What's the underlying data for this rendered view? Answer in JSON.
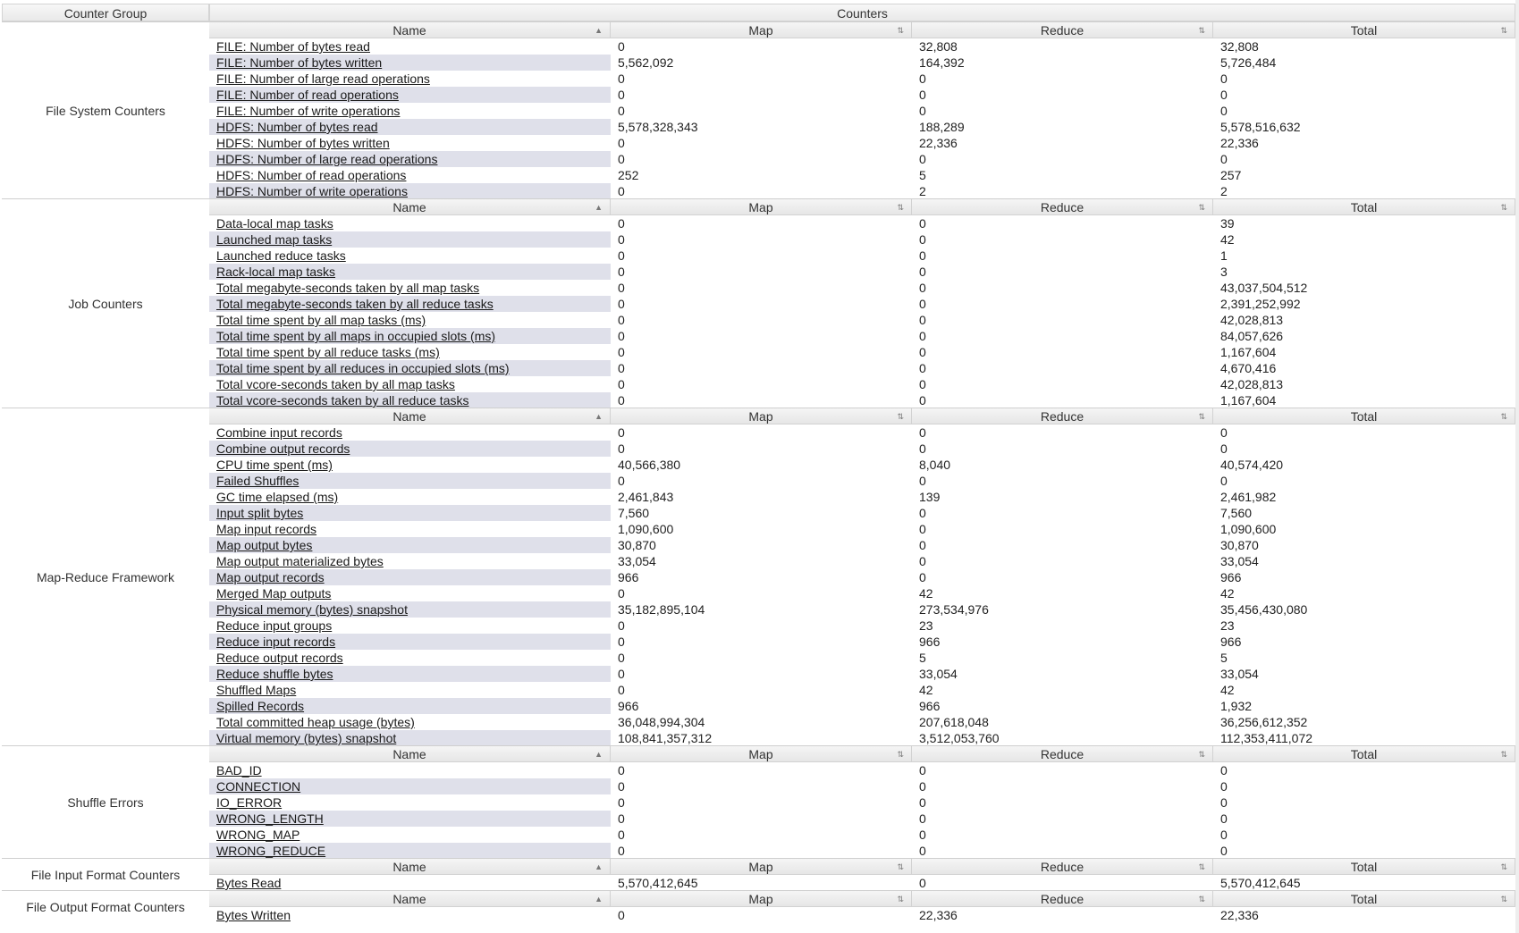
{
  "header": {
    "group_col": "Counter Group",
    "counters_col": "Counters"
  },
  "columns": {
    "name": "Name",
    "map": "Map",
    "reduce": "Reduce",
    "total": "Total"
  },
  "groups": [
    {
      "name": "File System Counters",
      "rows": [
        [
          "FILE: Number of bytes read",
          "0",
          "32,808",
          "32,808"
        ],
        [
          "FILE: Number of bytes written",
          "5,562,092",
          "164,392",
          "5,726,484"
        ],
        [
          "FILE: Number of large read operations",
          "0",
          "0",
          "0"
        ],
        [
          "FILE: Number of read operations",
          "0",
          "0",
          "0"
        ],
        [
          "FILE: Number of write operations",
          "0",
          "0",
          "0"
        ],
        [
          "HDFS: Number of bytes read",
          "5,578,328,343",
          "188,289",
          "5,578,516,632"
        ],
        [
          "HDFS: Number of bytes written",
          "0",
          "22,336",
          "22,336"
        ],
        [
          "HDFS: Number of large read operations",
          "0",
          "0",
          "0"
        ],
        [
          "HDFS: Number of read operations",
          "252",
          "5",
          "257"
        ],
        [
          "HDFS: Number of write operations",
          "0",
          "2",
          "2"
        ]
      ]
    },
    {
      "name": "Job Counters",
      "rows": [
        [
          "Data-local map tasks",
          "0",
          "0",
          "39"
        ],
        [
          "Launched map tasks",
          "0",
          "0",
          "42"
        ],
        [
          "Launched reduce tasks",
          "0",
          "0",
          "1"
        ],
        [
          "Rack-local map tasks",
          "0",
          "0",
          "3"
        ],
        [
          "Total megabyte-seconds taken by all map tasks",
          "0",
          "0",
          "43,037,504,512"
        ],
        [
          "Total megabyte-seconds taken by all reduce tasks",
          "0",
          "0",
          "2,391,252,992"
        ],
        [
          "Total time spent by all map tasks (ms)",
          "0",
          "0",
          "42,028,813"
        ],
        [
          "Total time spent by all maps in occupied slots (ms)",
          "0",
          "0",
          "84,057,626"
        ],
        [
          "Total time spent by all reduce tasks (ms)",
          "0",
          "0",
          "1,167,604"
        ],
        [
          "Total time spent by all reduces in occupied slots (ms)",
          "0",
          "0",
          "4,670,416"
        ],
        [
          "Total vcore-seconds taken by all map tasks",
          "0",
          "0",
          "42,028,813"
        ],
        [
          "Total vcore-seconds taken by all reduce tasks",
          "0",
          "0",
          "1,167,604"
        ]
      ]
    },
    {
      "name": "Map-Reduce Framework",
      "rows": [
        [
          "Combine input records",
          "0",
          "0",
          "0"
        ],
        [
          "Combine output records",
          "0",
          "0",
          "0"
        ],
        [
          "CPU time spent (ms)",
          "40,566,380",
          "8,040",
          "40,574,420"
        ],
        [
          "Failed Shuffles",
          "0",
          "0",
          "0"
        ],
        [
          "GC time elapsed (ms)",
          "2,461,843",
          "139",
          "2,461,982"
        ],
        [
          "Input split bytes",
          "7,560",
          "0",
          "7,560"
        ],
        [
          "Map input records",
          "1,090,600",
          "0",
          "1,090,600"
        ],
        [
          "Map output bytes",
          "30,870",
          "0",
          "30,870"
        ],
        [
          "Map output materialized bytes",
          "33,054",
          "0",
          "33,054"
        ],
        [
          "Map output records",
          "966",
          "0",
          "966"
        ],
        [
          "Merged Map outputs",
          "0",
          "42",
          "42"
        ],
        [
          "Physical memory (bytes) snapshot",
          "35,182,895,104",
          "273,534,976",
          "35,456,430,080"
        ],
        [
          "Reduce input groups",
          "0",
          "23",
          "23"
        ],
        [
          "Reduce input records",
          "0",
          "966",
          "966"
        ],
        [
          "Reduce output records",
          "0",
          "5",
          "5"
        ],
        [
          "Reduce shuffle bytes",
          "0",
          "33,054",
          "33,054"
        ],
        [
          "Shuffled Maps",
          "0",
          "42",
          "42"
        ],
        [
          "Spilled Records",
          "966",
          "966",
          "1,932"
        ],
        [
          "Total committed heap usage (bytes)",
          "36,048,994,304",
          "207,618,048",
          "36,256,612,352"
        ],
        [
          "Virtual memory (bytes) snapshot",
          "108,841,357,312",
          "3,512,053,760",
          "112,353,411,072"
        ]
      ]
    },
    {
      "name": "Shuffle Errors",
      "rows": [
        [
          "BAD_ID",
          "0",
          "0",
          "0"
        ],
        [
          "CONNECTION",
          "0",
          "0",
          "0"
        ],
        [
          "IO_ERROR",
          "0",
          "0",
          "0"
        ],
        [
          "WRONG_LENGTH",
          "0",
          "0",
          "0"
        ],
        [
          "WRONG_MAP",
          "0",
          "0",
          "0"
        ],
        [
          "WRONG_REDUCE",
          "0",
          "0",
          "0"
        ]
      ]
    },
    {
      "name": "File Input Format Counters",
      "rows": [
        [
          "Bytes Read",
          "5,570,412,645",
          "0",
          "5,570,412,645"
        ]
      ]
    },
    {
      "name": "File Output Format Counters",
      "rows": [
        [
          "Bytes Written",
          "0",
          "22,336",
          "22,336"
        ]
      ]
    }
  ]
}
